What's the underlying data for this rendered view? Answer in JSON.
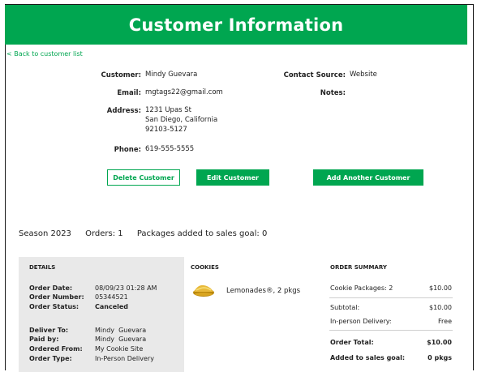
{
  "header": {
    "title": "Customer Information"
  },
  "nav": {
    "back_label": "< Back to customer list"
  },
  "customer": {
    "customer_label": "Customer:",
    "customer_name": "Mindy Guevara",
    "email_label": "Email:",
    "email": "mgtags22@gmail.com",
    "address_label": "Address:",
    "address_line1": "1231 Upas St",
    "address_line2": "San Diego, California",
    "address_line3": "92103-5127",
    "phone_label": "Phone:",
    "phone": "619-555-5555",
    "contact_source_label": "Contact Source:",
    "contact_source": "Website",
    "notes_label": "Notes:"
  },
  "actions": {
    "delete_label": "Delete Customer",
    "edit_label": "Edit Customer",
    "add_label": "Add Another Customer"
  },
  "summary_bar": {
    "season": "Season 2023",
    "orders": "Orders: 1",
    "packages": "Packages added to sales goal: 0"
  },
  "details": {
    "title": "DETAILS",
    "order_date_label": "Order Date:",
    "order_date": "08/09/23 01:28 AM",
    "order_number_label": "Order Number:",
    "order_number": "05344521",
    "order_status_label": "Order Status:",
    "order_status": "Canceled",
    "deliver_to_label": "Deliver To:",
    "deliver_to": "Mindy  Guevara",
    "paid_by_label": "Paid by:",
    "paid_by": "Mindy  Guevara",
    "ordered_from_label": "Ordered From:",
    "ordered_from": "My Cookie Site",
    "order_type_label": "Order Type:",
    "order_type": "In-Person Delivery"
  },
  "cookies": {
    "title": "COOKIES",
    "items": [
      {
        "name": "Lemonades®, 2 pkgs",
        "icon": "lemonade-cookie-icon"
      }
    ]
  },
  "order_summary": {
    "title": "ORDER SUMMARY",
    "cookie_packages_label": "Cookie Packages: 2",
    "cookie_packages_value": "$10.00",
    "subtotal_label": "Subtotal:",
    "subtotal_value": "$10.00",
    "delivery_label": "In-person Delivery:",
    "delivery_value": "Free",
    "total_label": "Order Total:",
    "total_value": "$10.00",
    "goal_label": "Added to sales goal:",
    "goal_value": "0 pkgs"
  },
  "colors": {
    "accent": "#00a650",
    "details_bg": "#e9e9e9"
  }
}
